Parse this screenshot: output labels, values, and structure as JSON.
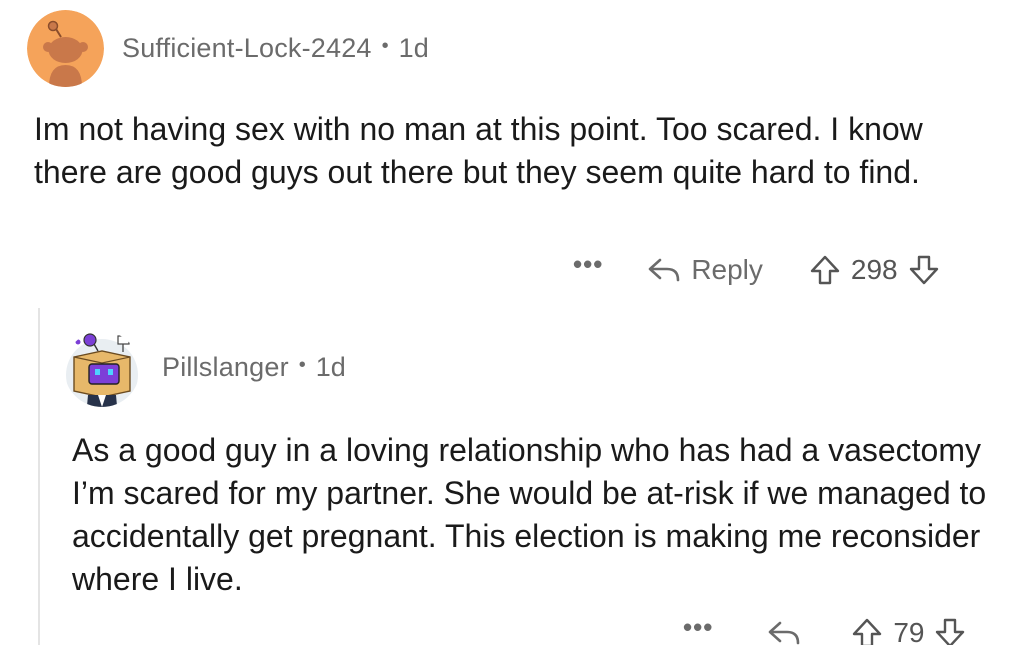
{
  "comments": [
    {
      "username": "Sufficient-Lock-2424",
      "separator": "•",
      "age": "1d",
      "avatar_icon": "snoo-avatar-icon",
      "avatar_bg": "#f5a35a",
      "body": "Im not having sex with no man at this point. Too scared. I know there are good guys out there but they seem quite hard to find.",
      "more": "•••",
      "reply_label": "Reply",
      "score": "298"
    },
    {
      "username": "Pillslanger",
      "separator": "•",
      "age": "1d",
      "avatar_icon": "box-head-avatar-icon",
      "body": "As a good guy in a loving relationship who has had a vasectomy I’m scared for my partner. She would be at-risk if we managed to accidentally get pregnant. This election is making me reconsider where I live.",
      "more": "•••",
      "score": "79"
    }
  ]
}
